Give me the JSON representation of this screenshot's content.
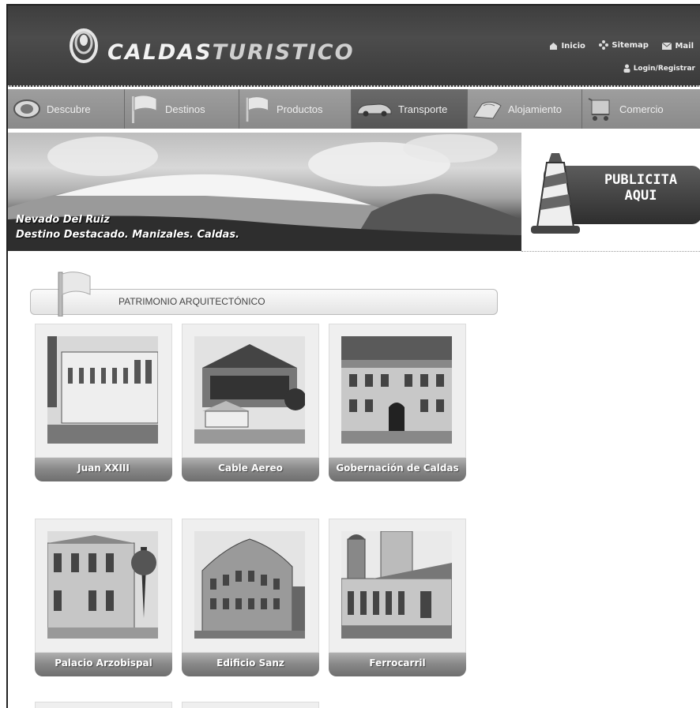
{
  "brand": {
    "part1": "CALDAS",
    "part2": "TURISTICO"
  },
  "toplinks": [
    {
      "label": "Inicio",
      "icon": "home-icon"
    },
    {
      "label": "Sitemap",
      "icon": "sitemap-icon"
    },
    {
      "label": "Mail",
      "icon": "mail-icon"
    }
  ],
  "login": {
    "label": "Login/Registrar",
    "icon": "user-icon"
  },
  "nav": [
    {
      "label": "Descubre",
      "icon": "eye-icon"
    },
    {
      "label": "Destinos",
      "icon": "flag-icon"
    },
    {
      "label": "Productos",
      "icon": "flag-icon"
    },
    {
      "label": "Transporte",
      "icon": "car-icon"
    },
    {
      "label": "Alojamiento",
      "icon": "bed-icon"
    },
    {
      "label": "Comercio",
      "icon": "cart-icon"
    }
  ],
  "banner": {
    "line1": "Nevado Del Ruiz",
    "line2": "Destino Destacado. Manizales. Caldas."
  },
  "publicita": {
    "line1": "PUBLICITA",
    "line2": "AQUI"
  },
  "section": {
    "title": "PATRIMONIO ARQUITECTÓNICO"
  },
  "cards": [
    {
      "label": "Juan XXIII"
    },
    {
      "label": "Cable Aereo"
    },
    {
      "label": "Gobernación de Caldas"
    },
    {
      "label": "Palacio Arzobispal"
    },
    {
      "label": "Edificio Sanz"
    },
    {
      "label": "Ferrocarril"
    }
  ]
}
